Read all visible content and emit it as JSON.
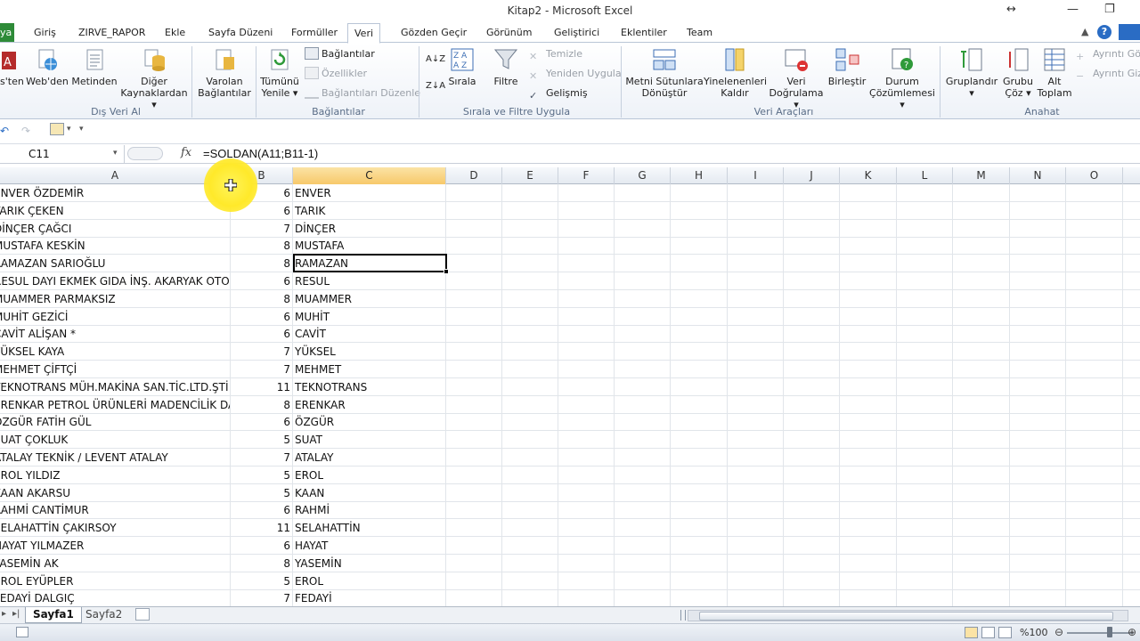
{
  "window": {
    "title": "Kitap2 - Microsoft Excel"
  },
  "ribbon_tabs": [
    {
      "label": "ya",
      "kind": "file"
    },
    {
      "label": "Giriş"
    },
    {
      "label": "ZIRVE_RAPOR"
    },
    {
      "label": "Ekle"
    },
    {
      "label": "Sayfa Düzeni"
    },
    {
      "label": "Formüller"
    },
    {
      "label": "Veri",
      "active": true
    },
    {
      "label": "Gözden Geçir"
    },
    {
      "label": "Görünüm"
    },
    {
      "label": "Geliştirici"
    },
    {
      "label": "Eklentiler"
    },
    {
      "label": "Team"
    }
  ],
  "ribbon": {
    "groups": {
      "dis_veri": "Dış Veri Al",
      "baglantilar": "Bağlantılar",
      "sirala": "Sırala ve Filtre Uygula",
      "veri_araclari": "Veri Araçları",
      "anahat": "Anahat"
    },
    "buttons": {
      "access": "s'ten",
      "web": "Web'den",
      "metin": "Metinden",
      "diger_1": "Diğer",
      "diger_2": "Kaynaklardan",
      "varolan_1": "Varolan",
      "varolan_2": "Bağlantılar",
      "tumunu_1": "Tümünü",
      "tumunu_2": "Yenile",
      "baglantilar_small": "Bağlantılar",
      "ozellikler": "Özellikler",
      "baglanti_duzenle": "Bağlantıları Düzenle",
      "sirala": "Sırala",
      "filtre": "Filtre",
      "temizle": "Temizle",
      "yeniden": "Yeniden Uygula",
      "gelismis": "Gelişmiş",
      "metni_1": "Metni Sütunlara",
      "metni_2": "Dönüştür",
      "yinelenen_1": "Yinelenenleri",
      "yinelenen_2": "Kaldır",
      "dogrulama_1": "Veri",
      "dogrulama_2": "Doğrulama",
      "birlestir": "Birleştir",
      "durum_1": "Durum",
      "durum_2": "Çözümlemesi",
      "grupla": "Gruplandır",
      "grubu_coz_1": "Grubu",
      "grubu_coz_2": "Çöz",
      "alt_toplam_1": "Alt",
      "alt_toplam_2": "Toplam",
      "ayrinti_goster": "Ayrıntı Gös",
      "ayrinti_gizle": "Ayrıntı Gizl"
    }
  },
  "formula_bar": {
    "name_box": "C11",
    "fx": "fx",
    "formula": "=SOLDAN(A11;B11-1)"
  },
  "columns": [
    "A",
    "B",
    "C",
    "D",
    "E",
    "F",
    "G",
    "H",
    "I",
    "J",
    "K",
    "L",
    "M",
    "N",
    "O"
  ],
  "rows": [
    {
      "a": "ENVER ÖZDEMİR",
      "b": "6",
      "c": "ENVER"
    },
    {
      "a": "TARIK ÇEKEN",
      "b": "6",
      "c": "TARIK"
    },
    {
      "a": "DİNÇER ÇAĞCI",
      "b": "7",
      "c": "DİNÇER"
    },
    {
      "a": "MUSTAFA KESKİN",
      "b": "8",
      "c": "MUSTAFA"
    },
    {
      "a": "RAMAZAN SARIOĞLU",
      "b": "8",
      "c": "RAMAZAN"
    },
    {
      "a": "RESUL DAYI EKMEK GIDA İNŞ. AKARYAK OTO",
      "b": "6",
      "c": "RESUL"
    },
    {
      "a": "MUAMMER PARMAKSIZ",
      "b": "8",
      "c": "MUAMMER"
    },
    {
      "a": "MUHİT GEZİCİ",
      "b": "6",
      "c": "MUHİT"
    },
    {
      "a": "CAVİT ALİŞAN *",
      "b": "6",
      "c": "CAVİT"
    },
    {
      "a": "YÜKSEL KAYA",
      "b": "7",
      "c": "YÜKSEL"
    },
    {
      "a": "MEHMET ÇİFTÇİ",
      "b": "7",
      "c": "MEHMET"
    },
    {
      "a": "TEKNOTRANS MÜH.MAKİNA SAN.TİC.LTD.ŞTİ",
      "b": "11",
      "c": "TEKNOTRANS"
    },
    {
      "a": "ERENKAR PETROL ÜRÜNLERİ MADENCİLİK DAN",
      "b": "8",
      "c": "ERENKAR"
    },
    {
      "a": "ÖZGÜR FATİH GÜL",
      "b": "6",
      "c": "ÖZGÜR"
    },
    {
      "a": "SUAT ÇOKLUK",
      "b": "5",
      "c": "SUAT"
    },
    {
      "a": "ATALAY TEKNİK / LEVENT ATALAY",
      "b": "7",
      "c": "ATALAY"
    },
    {
      "a": "EROL YILDIZ",
      "b": "5",
      "c": "EROL"
    },
    {
      "a": "KAAN AKARSU",
      "b": "5",
      "c": "KAAN"
    },
    {
      "a": "RAHMİ CANTİMUR",
      "b": "6",
      "c": "RAHMİ"
    },
    {
      "a": "SELAHATTİN ÇAKIRSOY",
      "b": "11",
      "c": "SELAHATTİN"
    },
    {
      "a": "HAYAT YILMAZER",
      "b": "6",
      "c": "HAYAT"
    },
    {
      "a": "YASEMİN AK",
      "b": "8",
      "c": "YASEMİN"
    },
    {
      "a": "EROL EYÜPLER",
      "b": "5",
      "c": "EROL"
    },
    {
      "a": "FEDAYİ DALGIÇ",
      "b": "7",
      "c": "FEDAYİ"
    }
  ],
  "sheets": [
    {
      "label": "Sayfa1",
      "active": true
    },
    {
      "label": "Sayfa2"
    }
  ],
  "status": {
    "zoom": "%100"
  },
  "colors": {
    "file_tab": "#2e8b38",
    "selected_header": "#f7c96a",
    "cursor_highlight": "#ffe92a"
  }
}
